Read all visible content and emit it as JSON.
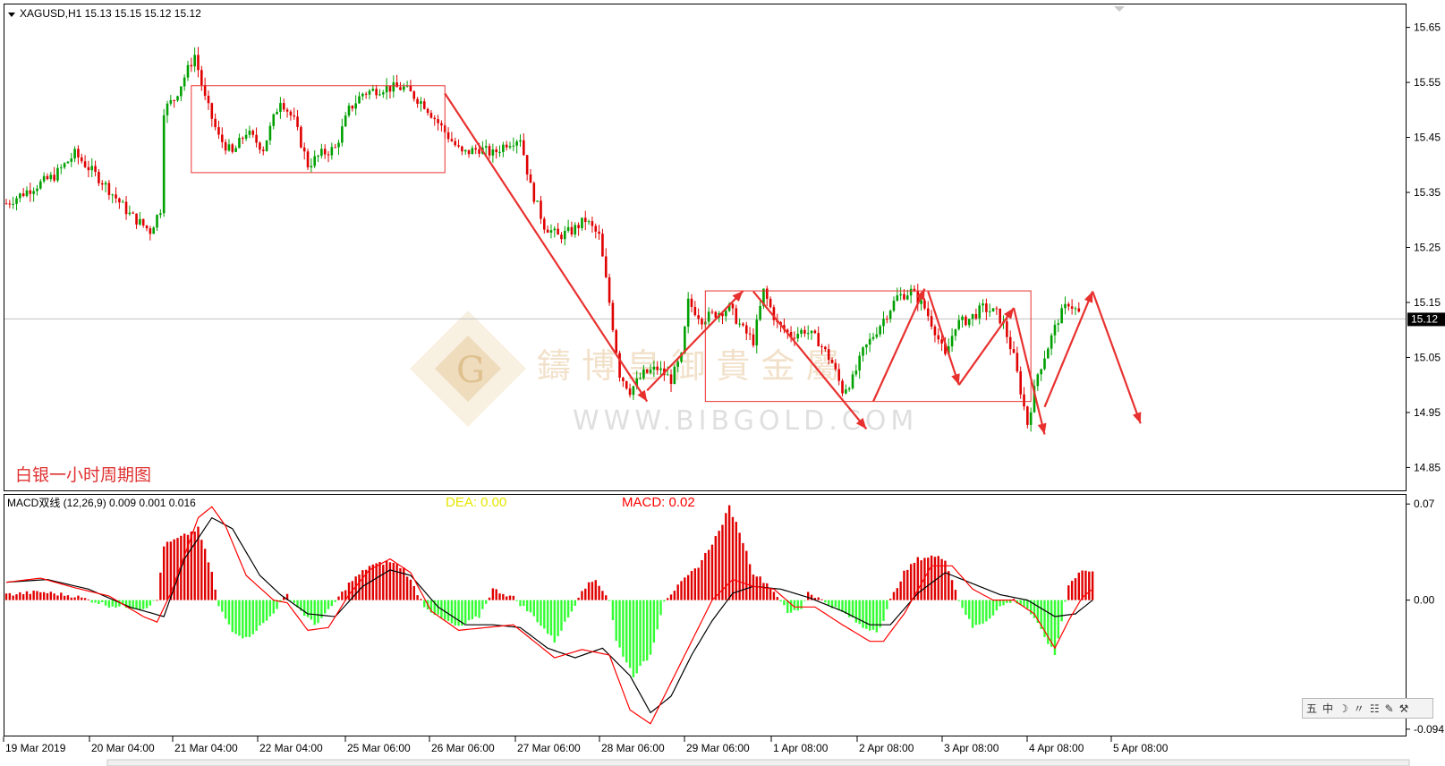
{
  "chart_data": {
    "type": "candlestick",
    "symbol_header": "XAGUSD,H1  15.13 15.15 15.12 15.12",
    "chart_label": "白银一小时周期图",
    "price_axis": {
      "min": 14.81,
      "max": 15.69,
      "ticks": [
        "15.65",
        "15.55",
        "15.45",
        "15.35",
        "15.25",
        "15.15",
        "15.05",
        "14.95",
        "14.85"
      ]
    },
    "current_price": 15.12,
    "current_price_label": "15.12",
    "x_ticks": [
      "19 Mar 2019",
      "20 Mar 04:00",
      "21 Mar 04:00",
      "22 Mar 04:00",
      "25 Mar 06:00",
      "26 Mar 06:00",
      "27 Mar 06:00",
      "28 Mar 06:00",
      "29 Mar 06:00",
      "1 Apr 08:00",
      "2 Apr 08:00",
      "3 Apr 08:00",
      "4 Apr 08:00",
      "5 Apr 08:00"
    ],
    "key_closes": [
      [
        0,
        15.33
      ],
      [
        8,
        15.36
      ],
      [
        14,
        15.38
      ],
      [
        20,
        15.42
      ],
      [
        28,
        15.37
      ],
      [
        36,
        15.31
      ],
      [
        42,
        15.28
      ],
      [
        45,
        15.32
      ],
      [
        46,
        15.5
      ],
      [
        49,
        15.52
      ],
      [
        52,
        15.56
      ],
      [
        55,
        15.6
      ],
      [
        58,
        15.52
      ],
      [
        62,
        15.45
      ],
      [
        66,
        15.42
      ],
      [
        70,
        15.46
      ],
      [
        75,
        15.43
      ],
      [
        80,
        15.52
      ],
      [
        84,
        15.48
      ],
      [
        88,
        15.4
      ],
      [
        92,
        15.42
      ],
      [
        96,
        15.43
      ],
      [
        100,
        15.5
      ],
      [
        104,
        15.53
      ],
      [
        110,
        15.54
      ],
      [
        116,
        15.54
      ],
      [
        122,
        15.51
      ],
      [
        128,
        15.46
      ],
      [
        133,
        15.42
      ],
      [
        138,
        15.43
      ],
      [
        142,
        15.42
      ],
      [
        146,
        15.44
      ],
      [
        150,
        15.45
      ],
      [
        153,
        15.36
      ],
      [
        157,
        15.29
      ],
      [
        161,
        15.27
      ],
      [
        165,
        15.28
      ],
      [
        169,
        15.3
      ],
      [
        173,
        15.27
      ],
      [
        176,
        15.15
      ],
      [
        179,
        15.02
      ],
      [
        182,
        14.99
      ],
      [
        186,
        15.02
      ],
      [
        190,
        15.03
      ],
      [
        194,
        15.01
      ],
      [
        197,
        15.05
      ],
      [
        199,
        15.15
      ],
      [
        203,
        15.12
      ],
      [
        207,
        15.13
      ],
      [
        211,
        15.14
      ],
      [
        215,
        15.1
      ],
      [
        218,
        15.08
      ],
      [
        221,
        15.17
      ],
      [
        225,
        15.11
      ],
      [
        229,
        15.09
      ],
      [
        233,
        15.1
      ],
      [
        237,
        15.08
      ],
      [
        241,
        15.04
      ],
      [
        244,
        14.99
      ],
      [
        247,
        15.01
      ],
      [
        250,
        15.06
      ],
      [
        253,
        15.09
      ],
      [
        257,
        15.13
      ],
      [
        260,
        15.16
      ],
      [
        264,
        15.17
      ],
      [
        268,
        15.14
      ],
      [
        271,
        15.1
      ],
      [
        274,
        15.05
      ],
      [
        277,
        15.11
      ],
      [
        281,
        15.12
      ],
      [
        285,
        15.14
      ],
      [
        289,
        15.13
      ],
      [
        291,
        15.11
      ],
      [
        294,
        15.05
      ],
      [
        296,
        14.99
      ],
      [
        298,
        14.93
      ],
      [
        301,
        15.02
      ],
      [
        304,
        15.07
      ],
      [
        307,
        15.12
      ],
      [
        310,
        15.15
      ],
      [
        313,
        15.13
      ]
    ],
    "macd": {
      "label": "MACD双线 (12,26,9) 0.009 0.001 0.016",
      "dea_label": "DEA:  0.00",
      "macd_label": "MACD:  0.02",
      "axis": {
        "min": -0.098,
        "max": 0.076,
        "ticks": [
          "0.07",
          "0.00",
          "-0.094"
        ]
      },
      "hist_keys": [
        [
          0,
          0.004
        ],
        [
          10,
          0.006
        ],
        [
          20,
          0.003
        ],
        [
          30,
          -0.004
        ],
        [
          40,
          -0.006
        ],
        [
          44,
          0.0
        ],
        [
          46,
          0.04
        ],
        [
          52,
          0.047
        ],
        [
          56,
          0.052
        ],
        [
          60,
          0.02
        ],
        [
          62,
          -0.005
        ],
        [
          66,
          -0.022
        ],
        [
          70,
          -0.028
        ],
        [
          76,
          -0.015
        ],
        [
          82,
          0.004
        ],
        [
          86,
          -0.008
        ],
        [
          90,
          -0.018
        ],
        [
          94,
          -0.008
        ],
        [
          100,
          0.012
        ],
        [
          106,
          0.025
        ],
        [
          112,
          0.028
        ],
        [
          116,
          0.023
        ],
        [
          120,
          0.005
        ],
        [
          122,
          -0.004
        ],
        [
          126,
          -0.012
        ],
        [
          132,
          -0.02
        ],
        [
          138,
          -0.012
        ],
        [
          142,
          0.008
        ],
        [
          148,
          0.002
        ],
        [
          150,
          -0.003
        ],
        [
          154,
          -0.012
        ],
        [
          160,
          -0.03
        ],
        [
          165,
          -0.008
        ],
        [
          168,
          0.008
        ],
        [
          172,
          0.015
        ],
        [
          176,
          0.0
        ],
        [
          178,
          -0.03
        ],
        [
          183,
          -0.055
        ],
        [
          188,
          -0.04
        ],
        [
          192,
          0.0
        ],
        [
          196,
          0.01
        ],
        [
          202,
          0.025
        ],
        [
          208,
          0.05
        ],
        [
          211,
          0.068
        ],
        [
          214,
          0.05
        ],
        [
          218,
          0.02
        ],
        [
          222,
          0.012
        ],
        [
          226,
          0.0
        ],
        [
          228,
          -0.01
        ],
        [
          232,
          -0.006
        ],
        [
          234,
          0.006
        ],
        [
          238,
          0.0
        ],
        [
          242,
          -0.006
        ],
        [
          246,
          -0.012
        ],
        [
          250,
          -0.02
        ],
        [
          254,
          -0.022
        ],
        [
          256,
          -0.015
        ],
        [
          258,
          0.0
        ],
        [
          262,
          0.02
        ],
        [
          266,
          0.03
        ],
        [
          270,
          0.032
        ],
        [
          274,
          0.03
        ],
        [
          276,
          0.015
        ],
        [
          278,
          0.0
        ],
        [
          282,
          -0.02
        ],
        [
          286,
          -0.015
        ],
        [
          290,
          -0.005
        ],
        [
          294,
          0.0
        ],
        [
          298,
          -0.006
        ],
        [
          302,
          -0.022
        ],
        [
          306,
          -0.04
        ],
        [
          308,
          -0.015
        ],
        [
          310,
          0.012
        ],
        [
          314,
          0.022
        ],
        [
          317,
          0.02
        ]
      ],
      "line1_keys": [
        [
          0,
          0.013
        ],
        [
          10,
          0.016
        ],
        [
          20,
          0.009
        ],
        [
          30,
          0.003
        ],
        [
          40,
          -0.012
        ],
        [
          44,
          -0.016
        ],
        [
          48,
          0.005
        ],
        [
          56,
          0.06
        ],
        [
          60,
          0.068
        ],
        [
          64,
          0.054
        ],
        [
          70,
          0.018
        ],
        [
          78,
          0.0
        ],
        [
          82,
          -0.002
        ],
        [
          88,
          -0.022
        ],
        [
          94,
          -0.02
        ],
        [
          100,
          0.004
        ],
        [
          106,
          0.022
        ],
        [
          112,
          0.03
        ],
        [
          118,
          0.02
        ],
        [
          124,
          -0.008
        ],
        [
          132,
          -0.022
        ],
        [
          140,
          -0.02
        ],
        [
          148,
          -0.018
        ],
        [
          154,
          -0.03
        ],
        [
          160,
          -0.042
        ],
        [
          168,
          -0.036
        ],
        [
          176,
          -0.04
        ],
        [
          182,
          -0.08
        ],
        [
          188,
          -0.09
        ],
        [
          194,
          -0.06
        ],
        [
          200,
          -0.03
        ],
        [
          206,
          0.0
        ],
        [
          212,
          0.015
        ],
        [
          218,
          0.01
        ],
        [
          224,
          0.008
        ],
        [
          230,
          -0.005
        ],
        [
          236,
          -0.005
        ],
        [
          244,
          -0.018
        ],
        [
          252,
          -0.03
        ],
        [
          256,
          -0.03
        ],
        [
          262,
          -0.01
        ],
        [
          270,
          0.025
        ],
        [
          276,
          0.025
        ],
        [
          282,
          0.008
        ],
        [
          288,
          0.0
        ],
        [
          294,
          0.0
        ],
        [
          300,
          -0.01
        ],
        [
          306,
          -0.035
        ],
        [
          310,
          -0.015
        ],
        [
          314,
          0.002
        ],
        [
          317,
          0.008
        ]
      ],
      "line2_keys": [
        [
          0,
          0.013
        ],
        [
          12,
          0.015
        ],
        [
          24,
          0.008
        ],
        [
          36,
          -0.005
        ],
        [
          46,
          -0.012
        ],
        [
          52,
          0.03
        ],
        [
          60,
          0.06
        ],
        [
          66,
          0.052
        ],
        [
          74,
          0.018
        ],
        [
          80,
          0.004
        ],
        [
          88,
          -0.01
        ],
        [
          96,
          -0.012
        ],
        [
          104,
          0.01
        ],
        [
          112,
          0.022
        ],
        [
          118,
          0.018
        ],
        [
          126,
          -0.005
        ],
        [
          134,
          -0.018
        ],
        [
          142,
          -0.018
        ],
        [
          150,
          -0.02
        ],
        [
          158,
          -0.035
        ],
        [
          166,
          -0.042
        ],
        [
          174,
          -0.035
        ],
        [
          182,
          -0.055
        ],
        [
          188,
          -0.082
        ],
        [
          194,
          -0.07
        ],
        [
          200,
          -0.04
        ],
        [
          206,
          -0.015
        ],
        [
          212,
          0.005
        ],
        [
          218,
          0.01
        ],
        [
          226,
          0.008
        ],
        [
          234,
          0.002
        ],
        [
          244,
          -0.008
        ],
        [
          252,
          -0.018
        ],
        [
          258,
          -0.018
        ],
        [
          266,
          0.005
        ],
        [
          274,
          0.02
        ],
        [
          282,
          0.012
        ],
        [
          290,
          0.004
        ],
        [
          298,
          0.0
        ],
        [
          306,
          -0.012
        ],
        [
          312,
          -0.01
        ],
        [
          317,
          0.0
        ]
      ]
    },
    "colors": {
      "bull_candle": "#00a000",
      "bear_candle": "#e00000",
      "arrow": "#e8312f",
      "hist_pos": "#e00000",
      "hist_neg": "#33ff33",
      "macd_line": "#000000",
      "signal_line": "#ff0000",
      "dea_text": "#e6e600",
      "macd_text": "#ff0000",
      "label_text": "#e03030"
    }
  },
  "watermark": {
    "cn": "鑄 博 皇 御 貴 金 屬",
    "url": "WWW.BIBGOLD.COM",
    "logo_letter": "G"
  },
  "toolbar": {
    "items": [
      "五",
      "中",
      "☽",
      "〃",
      "☷",
      "✎",
      "⚒"
    ]
  }
}
